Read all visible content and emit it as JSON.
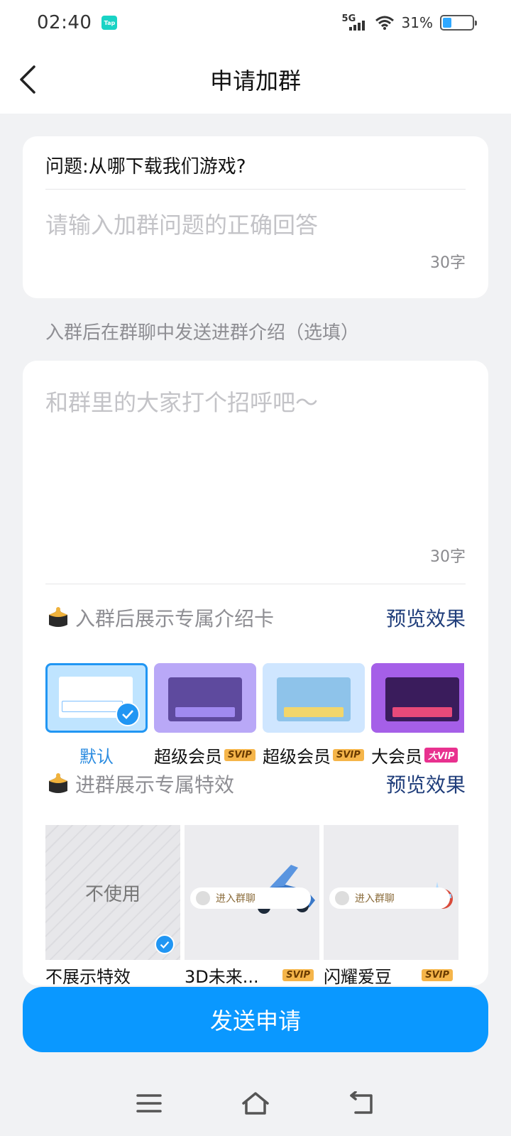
{
  "status": {
    "time": "02:40",
    "tap_label": "Tap",
    "network": "5G",
    "battery_pct": "31%",
    "battery_level": 0.31
  },
  "header": {
    "title": "申请加群"
  },
  "question_card": {
    "question": "问题:从哪下载我们游戏?",
    "answer_placeholder": "请输入加群问题的正确回答",
    "answer_value": "",
    "count": "30字"
  },
  "intro": {
    "label": "入群后在群聊中发送进群介绍（选填）",
    "placeholder": "和群里的大家打个招呼吧～",
    "count": "30字"
  },
  "intro_card_section": {
    "title": "入群后展示专属介绍卡",
    "preview": "预览效果",
    "options": [
      {
        "label": "默认",
        "badge": "",
        "selected": true
      },
      {
        "label": "超级会员",
        "badge": "SVIP",
        "selected": false
      },
      {
        "label": "超级会员",
        "badge": "SVIP",
        "selected": false
      },
      {
        "label": "大会员",
        "badge": "大VIP",
        "selected": false
      }
    ]
  },
  "effect_section": {
    "title": "进群展示专属特效",
    "preview": "预览效果",
    "none_text": "不使用",
    "pill_text": "进入群聊",
    "options": [
      {
        "label": "不展示特效",
        "badge": "",
        "selected": true
      },
      {
        "label": "3D未来...",
        "badge": "SVIP",
        "selected": false
      },
      {
        "label": "闪耀爱豆",
        "badge": "SVIP",
        "selected": false
      }
    ]
  },
  "send_button": "发送申请",
  "colors": {
    "accent": "#0a98ff",
    "link": "#1f3d7a",
    "svip": "#f5b54a",
    "bigvip": "#e8318f"
  }
}
